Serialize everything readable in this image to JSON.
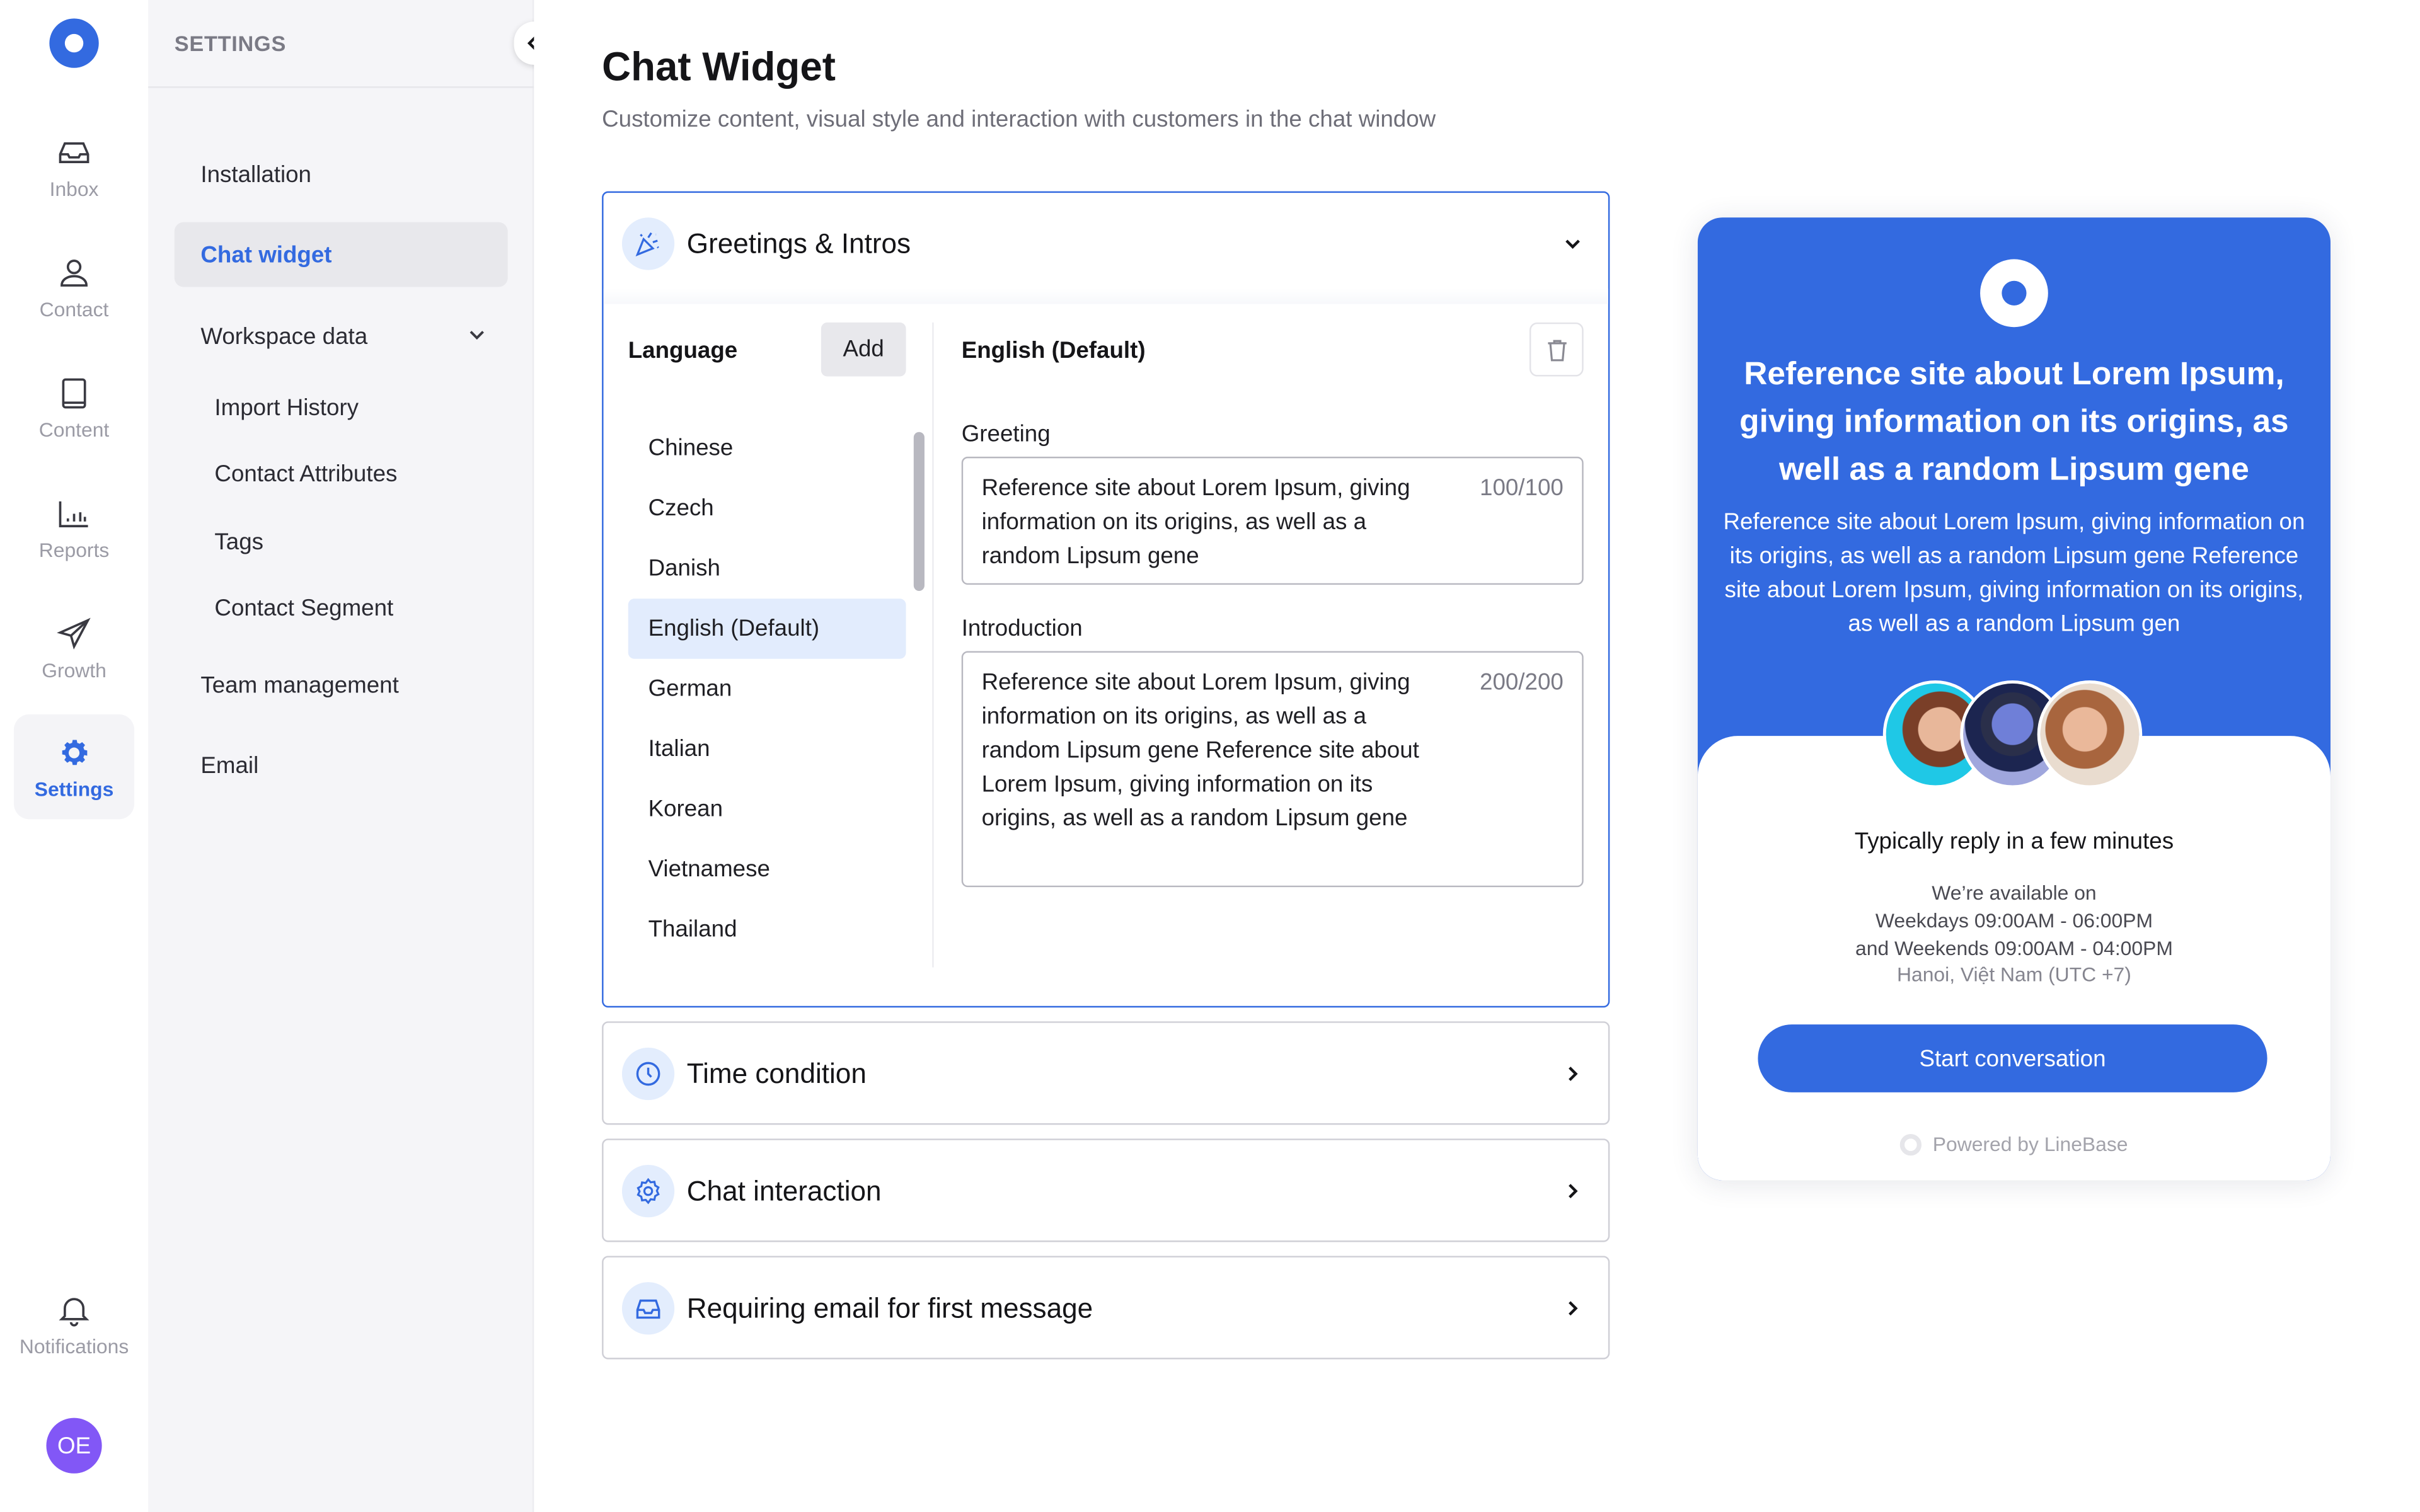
{
  "rail": {
    "items": [
      {
        "label": "Inbox",
        "icon": "inbox-icon"
      },
      {
        "label": "Contact",
        "icon": "user-icon"
      },
      {
        "label": "Content",
        "icon": "book-icon"
      },
      {
        "label": "Reports",
        "icon": "bar-chart-icon"
      },
      {
        "label": "Growth",
        "icon": "paper-plane-icon"
      },
      {
        "label": "Settings",
        "icon": "gear-icon",
        "active": true
      }
    ],
    "notifications_label": "Notifications",
    "avatar_initials": "OE",
    "accent": "#336ae0",
    "avatar_color": "#8257f6"
  },
  "settings_panel": {
    "title": "SETTINGS",
    "items": [
      {
        "label": "Installation"
      },
      {
        "label": "Chat widget",
        "active": true
      },
      {
        "label": "Workspace data",
        "expanded": true
      },
      {
        "label": "Import History",
        "sub": true
      },
      {
        "label": "Contact Attributes",
        "sub": true
      },
      {
        "label": "Tags",
        "sub": true
      },
      {
        "label": "Contact Segment",
        "sub": true
      },
      {
        "label": "Team management"
      },
      {
        "label": "Email"
      }
    ]
  },
  "page": {
    "title": "Chat Widget",
    "subtitle": "Customize content, visual style and interaction with customers in the chat window"
  },
  "greetings": {
    "title": "Greetings & Intros",
    "language_label": "Language",
    "add_label": "Add",
    "languages": [
      "Chinese",
      "Czech",
      "Danish",
      "English (Default)",
      "German",
      "Italian",
      "Korean",
      "Vietnamese",
      "Thailand"
    ],
    "selected_language": "English (Default)",
    "greeting_label": "Greeting",
    "greeting_value": "Reference site about Lorem Ipsum, giving information on its origins, as well as a random Lipsum gene",
    "greeting_counter": "100/100",
    "intro_label": "Introduction",
    "intro_value": "Reference site about Lorem Ipsum, giving information on its origins, as well as a random Lipsum gene Reference site about Lorem Ipsum, giving information on its origins, as well as a random Lipsum gene",
    "intro_counter": "200/200"
  },
  "sections": [
    {
      "title": "Time condition",
      "icon": "clock-icon"
    },
    {
      "title": "Chat interaction",
      "icon": "gear-icon"
    },
    {
      "title": "Requiring email for first message",
      "icon": "inbox-icon"
    }
  ],
  "preview": {
    "heading": "Reference site about Lorem Ipsum, giving information on its origins, as well as a random Lipsum gene",
    "body": "Reference site about Lorem Ipsum, giving information on its origins, as well as a random Lipsum gene Reference site about Lorem Ipsum, giving information on its origins, as well as a random Lipsum gen",
    "reply_time": "Typically reply in a few minutes",
    "availability": [
      "We’re available on",
      "Weekdays 09:00AM - 06:00PM",
      "and Weekends 09:00AM - 04:00PM"
    ],
    "timezone": "Hanoi, Việt Nam (UTC +7)",
    "button_label": "Start conversation",
    "powered_by": "Powered by LineBase",
    "brand_color": "#336ae0"
  }
}
